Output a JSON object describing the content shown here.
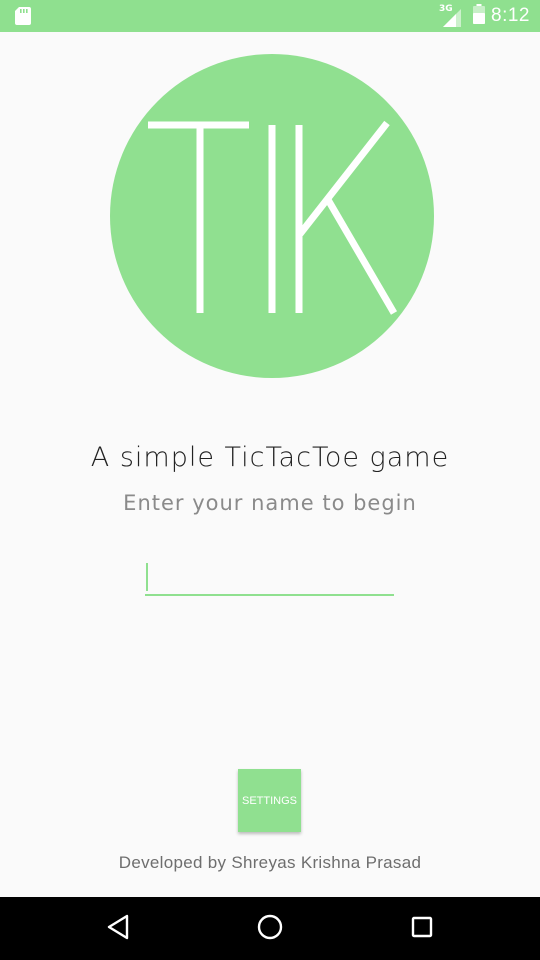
{
  "status_bar": {
    "network_type": "3G",
    "time": "8:12",
    "icons": [
      "sd-card-icon",
      "signal-icon",
      "battery-icon"
    ],
    "background_color": "#8fe08f"
  },
  "logo": {
    "text": "TIK",
    "circle_color": "#90e090",
    "letter_color": "#ffffff"
  },
  "main": {
    "tagline": "A simple TicTacToe game",
    "subtitle": "Enter your name to begin",
    "name_input": {
      "value": "",
      "placeholder": ""
    },
    "settings_label": "SETTINGS",
    "credits": "Developed by Shreyas Krishna Prasad"
  },
  "nav_bar": {
    "icons": [
      "back-icon",
      "home-icon",
      "recents-icon"
    ]
  },
  "colors": {
    "accent": "#8fe08f",
    "background": "#fafafa"
  }
}
